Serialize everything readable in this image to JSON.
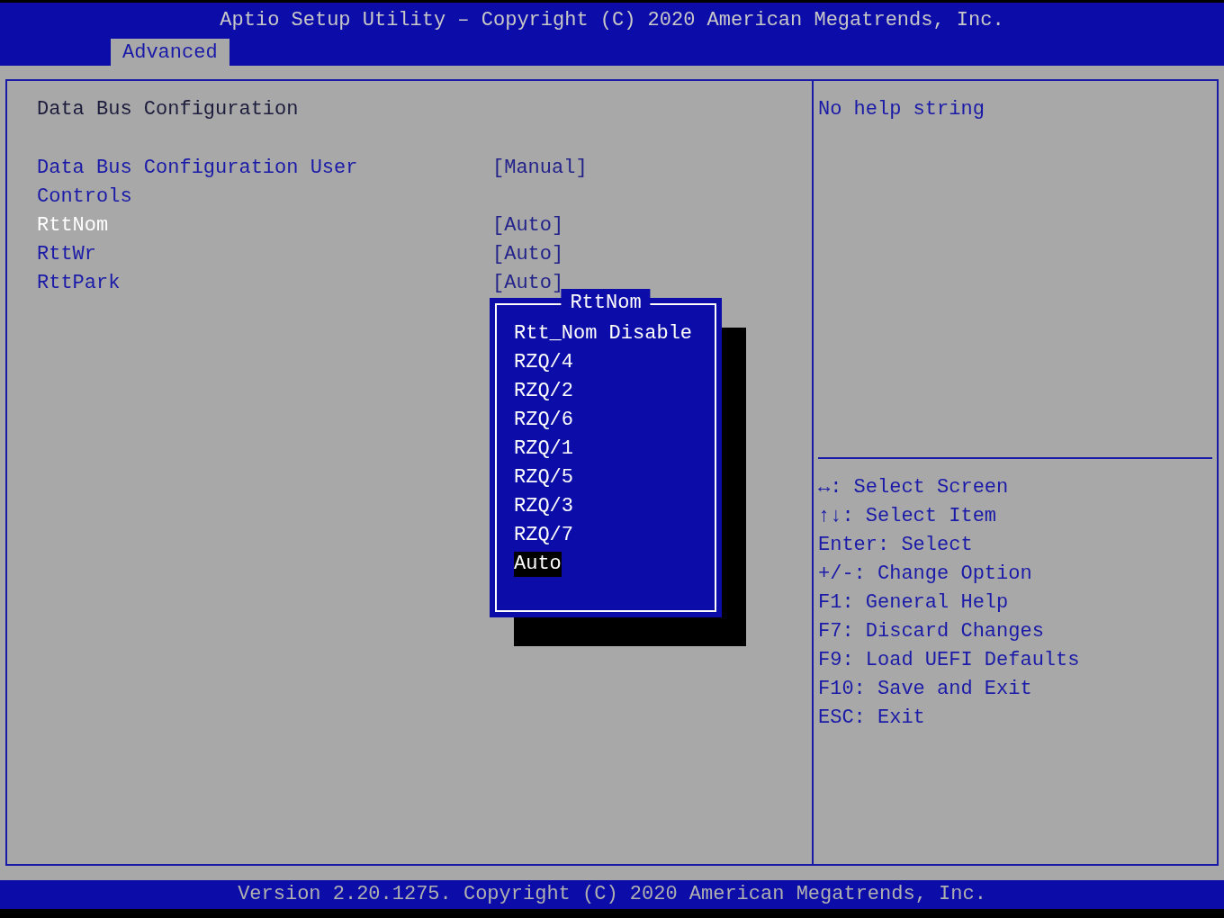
{
  "header": {
    "title": "Aptio Setup Utility – Copyright (C) 2020 American Megatrends, Inc.",
    "tabs": [
      {
        "label": "Advanced",
        "selected": true
      }
    ]
  },
  "main": {
    "heading": "Data Bus Configuration",
    "settings": [
      {
        "label": "Data Bus Configuration User Controls",
        "value": "[Manual]",
        "selected": false
      },
      {
        "label": "RttNom",
        "value": "[Auto]",
        "selected": true
      },
      {
        "label": "RttWr",
        "value": "[Auto]",
        "selected": false
      },
      {
        "label": "RttPark",
        "value": "[Auto]",
        "selected": false
      }
    ]
  },
  "popup": {
    "title": "RttNom",
    "options": [
      {
        "label": "Rtt_Nom Disable",
        "selected": false
      },
      {
        "label": "RZQ/4",
        "selected": false
      },
      {
        "label": "RZQ/2",
        "selected": false
      },
      {
        "label": "RZQ/6",
        "selected": false
      },
      {
        "label": "RZQ/1",
        "selected": false
      },
      {
        "label": "RZQ/5",
        "selected": false
      },
      {
        "label": "RZQ/3",
        "selected": false
      },
      {
        "label": "RZQ/7",
        "selected": false
      },
      {
        "label": "Auto",
        "selected": true
      }
    ]
  },
  "help": {
    "text": "No help string",
    "keys": [
      "↔: Select Screen",
      "↑↓: Select Item",
      "Enter: Select",
      "+/-: Change Option",
      "F1: General Help",
      "F7: Discard Changes",
      "F9: Load UEFI Defaults",
      "F10: Save and Exit",
      "ESC: Exit"
    ]
  },
  "footer": {
    "text": "Version 2.20.1275. Copyright (C) 2020 American Megatrends, Inc."
  }
}
